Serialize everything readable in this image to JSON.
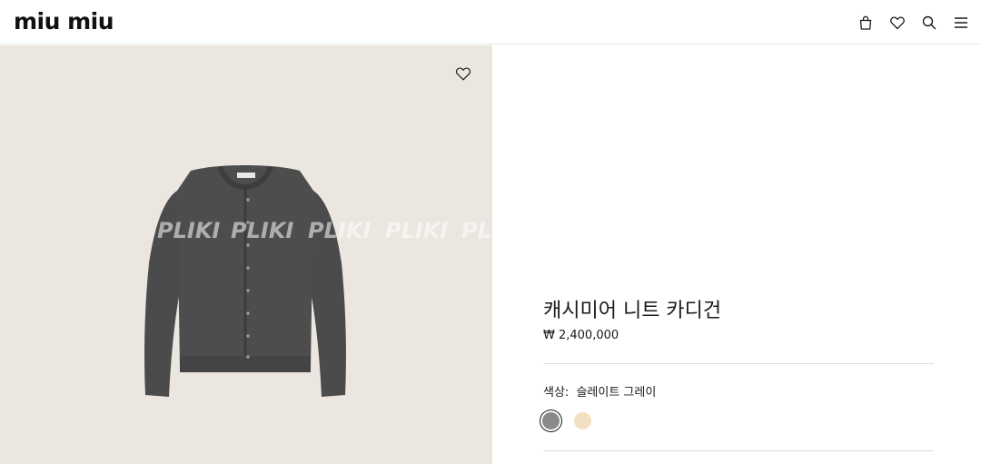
{
  "header": {
    "logo": "miu miu",
    "icons": [
      "bag-icon",
      "heart-icon",
      "search-icon",
      "menu-icon"
    ]
  },
  "image": {
    "watermark": "PLIKI",
    "background": "#ebe6df",
    "garment_color": "#4a4a4a"
  },
  "product": {
    "title": "캐시미어 니트 카디건",
    "price": "₩ 2,400,000",
    "color_label": "색상:",
    "color_value": "슬레이트 그레이",
    "swatches": [
      {
        "name": "slate-grey",
        "color": "#8a8a8a",
        "selected": true
      },
      {
        "name": "cream",
        "color": "#f3dfc1",
        "selected": false
      }
    ]
  }
}
